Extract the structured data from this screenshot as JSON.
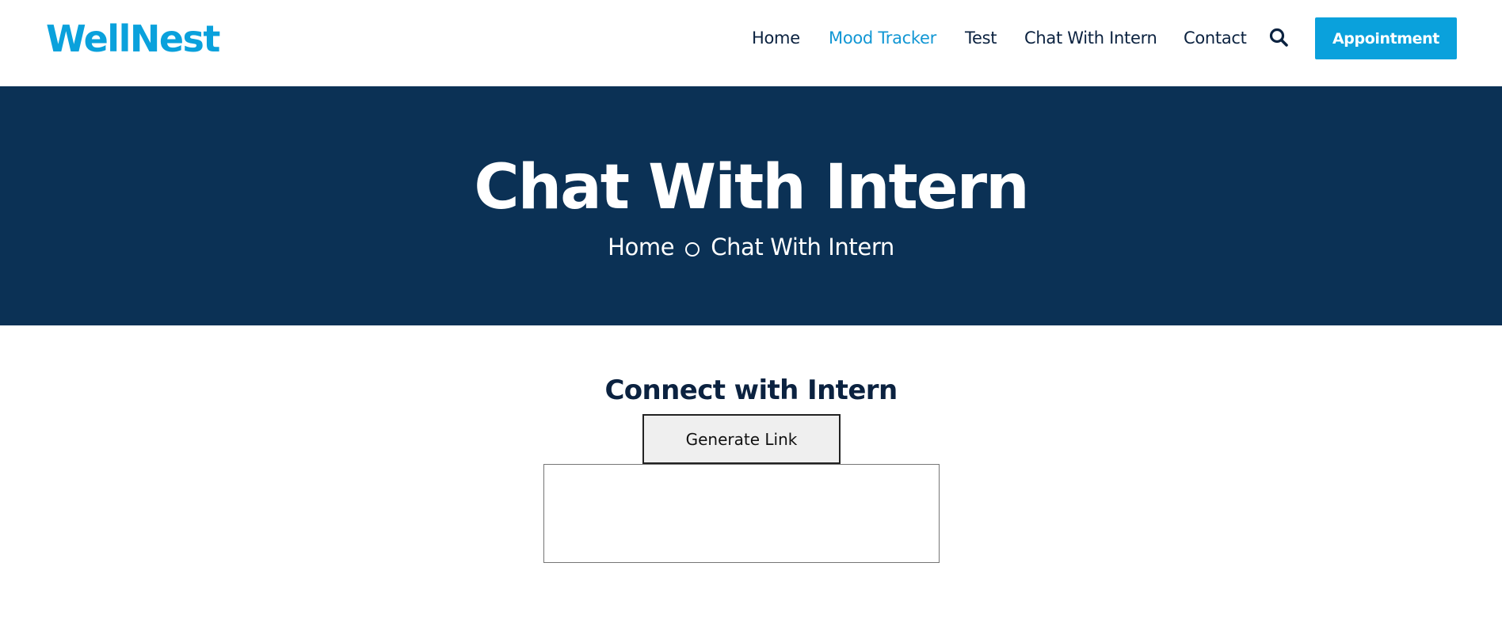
{
  "brand": {
    "name": "WellNest",
    "color": "#0aa1dc"
  },
  "nav": {
    "items": [
      {
        "label": "Home",
        "active": false
      },
      {
        "label": "Mood Tracker",
        "active": true
      },
      {
        "label": "Test",
        "active": false
      },
      {
        "label": "Chat With Intern",
        "active": false
      },
      {
        "label": "Contact",
        "active": false
      }
    ],
    "search_icon": "search-icon",
    "appointment_label": "Appointment"
  },
  "banner": {
    "title": "Chat With Intern",
    "breadcrumb": {
      "home": "Home",
      "current": "Chat With Intern"
    },
    "background": "#0b3155"
  },
  "main": {
    "section_title": "Connect with Intern",
    "generate_label": "Generate Link",
    "link_output": ""
  }
}
